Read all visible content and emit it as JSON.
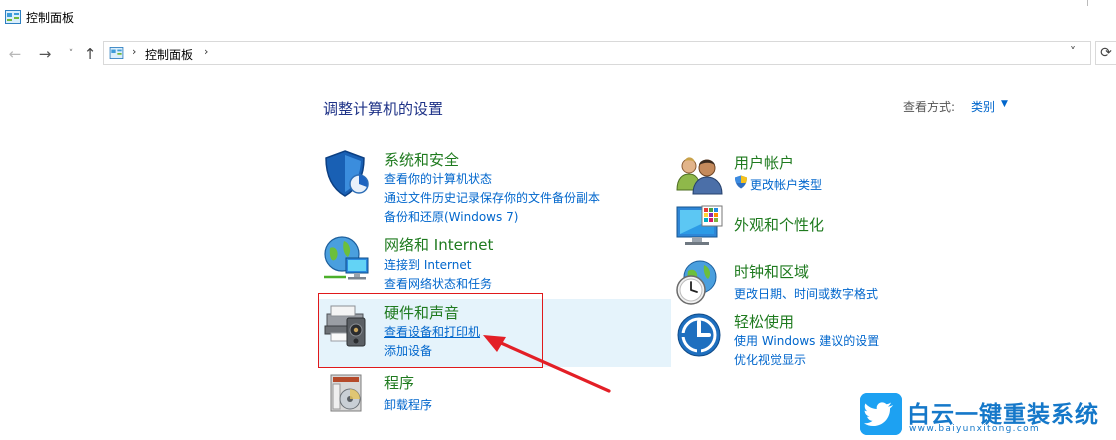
{
  "window": {
    "title": "控制面板"
  },
  "nav": {
    "back": "←",
    "forward": "→",
    "recent": "˅",
    "up": "↑",
    "refresh": "⟳"
  },
  "address": {
    "crumb": "控制面板",
    "chevron": "›",
    "dropdown": "˅"
  },
  "main": {
    "heading": "调整计算机的设置",
    "view_by_label": "查看方式:",
    "view_by_value": "类别"
  },
  "categories": {
    "system_security": {
      "title": "系统和安全",
      "links": [
        "查看你的计算机状态",
        "通过文件历史记录保存你的文件备份副本",
        "备份和还原(Windows 7)"
      ]
    },
    "network": {
      "title": "网络和 Internet",
      "links": [
        "连接到 Internet",
        "查看网络状态和任务"
      ]
    },
    "hardware": {
      "title": "硬件和声音",
      "links": [
        "查看设备和打印机",
        "添加设备"
      ]
    },
    "programs": {
      "title": "程序",
      "links": [
        "卸载程序"
      ]
    },
    "user_accounts": {
      "title": "用户帐户",
      "links": [
        "更改帐户类型"
      ]
    },
    "appearance": {
      "title": "外观和个性化"
    },
    "clock_region": {
      "title": "时钟和区域",
      "links": [
        "更改日期、时间或数字格式"
      ]
    },
    "ease_access": {
      "title": "轻松使用",
      "links": [
        "使用 Windows 建议的设置",
        "优化视觉显示"
      ]
    }
  },
  "watermark": {
    "name": "白云一键重装系统",
    "url": "www.baiyunxitong.com"
  },
  "colors": {
    "link": "#0066cc",
    "category": "#1e7a1e",
    "heading": "#1e3287",
    "highlight_box": "#e0191b",
    "hover_bg": "#e5f3fb",
    "arrow": "#e31f26"
  }
}
